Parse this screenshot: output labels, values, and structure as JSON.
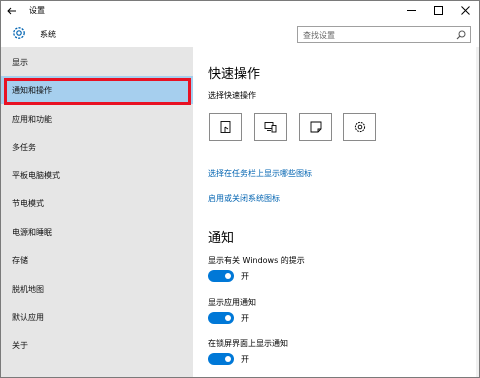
{
  "window": {
    "title": "设置",
    "controls": {
      "minimize": "—",
      "maximize": "☐",
      "close": "✕"
    }
  },
  "header": {
    "section_title": "系统",
    "search_placeholder": "查找设置"
  },
  "sidebar": {
    "selected_index": 1,
    "items": [
      {
        "label": "显示"
      },
      {
        "label": "通知和操作"
      },
      {
        "label": "应用和功能"
      },
      {
        "label": "多任务"
      },
      {
        "label": "平板电脑模式"
      },
      {
        "label": "节电模式"
      },
      {
        "label": "电源和睡眠"
      },
      {
        "label": "存储"
      },
      {
        "label": "脱机地图"
      },
      {
        "label": "默认应用"
      },
      {
        "label": "关于"
      }
    ]
  },
  "main": {
    "quick_actions": {
      "heading": "快速操作",
      "subheading": "选择快速操作",
      "buttons": [
        {
          "icon": "tablet-mode-icon"
        },
        {
          "icon": "connect-icon"
        },
        {
          "icon": "note-icon"
        },
        {
          "icon": "settings-icon"
        }
      ],
      "links": [
        "选择在任务栏上显示哪些图标",
        "启用或关闭系统图标"
      ]
    },
    "notifications": {
      "heading": "通知",
      "settings": [
        {
          "label": "显示有关 Windows 的提示",
          "state": "开",
          "on": true
        },
        {
          "label": "显示应用通知",
          "state": "开",
          "on": true
        },
        {
          "label": "在锁屏界面上显示通知",
          "state": "开",
          "on": true
        }
      ]
    }
  },
  "colors": {
    "accent": "#0078d7",
    "link": "#0063b1",
    "sidebar_bg": "#e6e6e6",
    "selected_bg": "#a6cfee",
    "highlight_border": "#e81123"
  }
}
